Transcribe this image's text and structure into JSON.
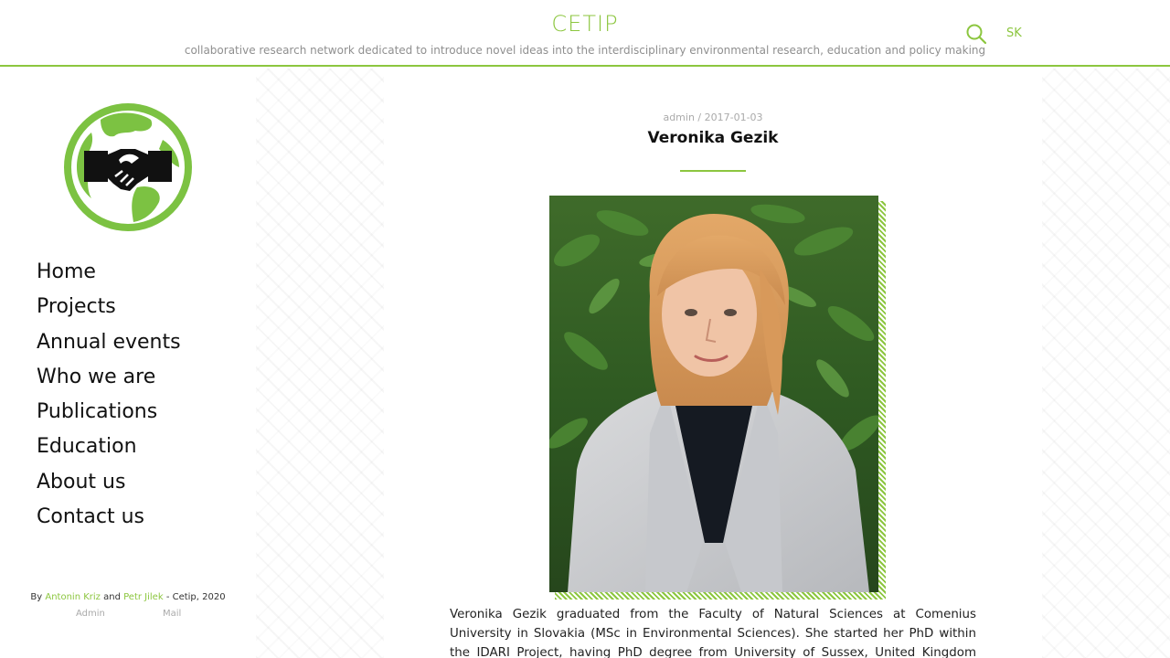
{
  "header": {
    "title": "CETIP",
    "tagline": "collaborative research network dedicated to introduce novel ideas into the interdisciplinary environmental research, education and policy making",
    "search_icon": "search-icon",
    "lang_label": "SK"
  },
  "sidebar": {
    "logo": "handshake-globe-logo",
    "nav": [
      {
        "label": "Home"
      },
      {
        "label": "Projects"
      },
      {
        "label": "Annual events"
      },
      {
        "label": "Who we are"
      },
      {
        "label": "Publications"
      },
      {
        "label": "Education"
      },
      {
        "label": "About us"
      },
      {
        "label": "Contact us"
      }
    ],
    "footer": {
      "by": "By",
      "author1": "Antonin Kriz",
      "and": "and",
      "author2": "Petr Jilek",
      "suffix": "- Cetip, 2020",
      "admin": "Admin",
      "mail": "Mail"
    }
  },
  "post": {
    "meta": "admin / 2017-01-03",
    "title": "Veronika Gezik",
    "body": "Veronika Gezik graduated from the Faculty of Natural Sciences at Comenius University in Slovakia (MSc in Environmental Sciences). She started her PhD within the IDARI Project, having PhD degree from University of Sussex, United Kingdom (PhD in Ecological Economics)."
  },
  "colors": {
    "accent": "#8cc63f",
    "text": "#111111",
    "muted": "#8f8f8f"
  }
}
